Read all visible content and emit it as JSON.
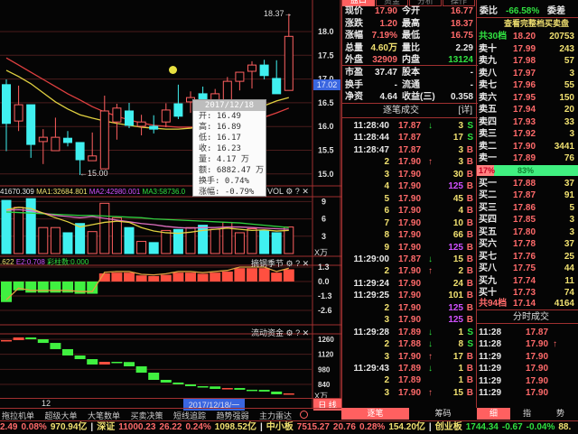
{
  "top_tabs": [
    "盘口",
    "资金",
    "分析",
    "操作"
  ],
  "kline": {
    "price_axis": [
      "18.0",
      "17.5",
      "17.0",
      "16.5",
      "16.0",
      "15.5",
      "15.0"
    ],
    "high_label": "18.37→",
    "low_label": "←15.00",
    "current_tag": "17.02",
    "candles": [
      [
        16.89,
        17.0,
        15.5,
        16.08
      ],
      [
        16.13,
        16.87,
        15.92,
        16.47
      ],
      [
        16.47,
        16.47,
        15.36,
        15.64
      ],
      [
        15.7,
        15.96,
        15.23,
        15.79
      ],
      [
        15.51,
        16.2,
        15.51,
        15.79
      ],
      [
        15.77,
        15.92,
        15.6,
        15.68
      ],
      [
        15.68,
        15.68,
        15.0,
        15.32
      ],
      [
        15.3,
        15.89,
        15.3,
        15.4
      ],
      [
        15.13,
        16.66,
        15.13,
        16.34
      ],
      [
        16.11,
        16.49,
        15.74,
        16.4
      ],
      [
        16.34,
        16.51,
        15.98,
        16.04
      ],
      [
        16.02,
        16.26,
        15.83,
        16.11
      ],
      [
        16.02,
        16.25,
        15.87,
        15.96
      ],
      [
        16.11,
        16.5,
        16.0,
        16.36
      ],
      [
        16.49,
        16.89,
        16.17,
        16.23
      ],
      [
        16.53,
        16.75,
        16.3,
        16.62
      ],
      [
        16.7,
        16.85,
        16.4,
        16.58
      ],
      [
        16.5,
        16.8,
        16.4,
        16.7
      ],
      [
        16.55,
        17.05,
        16.45,
        16.96
      ],
      [
        16.96,
        17.15,
        16.77,
        17.15
      ],
      [
        17.17,
        17.38,
        16.81,
        17.3
      ],
      [
        17.3,
        17.41,
        17.0,
        17.08
      ],
      [
        17.02,
        17.4,
        16.7,
        16.7
      ],
      [
        16.77,
        18.37,
        16.77,
        17.9
      ]
    ],
    "ma_short": [
      17.19,
      17.06,
      16.91,
      16.72,
      16.53,
      16.38,
      16.26,
      16.19,
      16.13,
      16.08,
      16.04,
      16.0,
      15.98,
      15.96,
      15.96,
      15.98,
      16.02,
      16.08,
      16.15,
      16.25,
      16.34,
      16.45,
      16.55,
      16.62
    ],
    "ma_long": [
      17.45,
      17.3,
      17.15,
      17.0,
      16.85,
      16.7,
      16.57,
      16.43,
      16.32,
      16.23,
      16.15,
      16.09,
      16.04,
      16.02,
      16.0,
      16.0,
      16.02,
      16.04,
      16.06,
      16.08,
      16.11,
      16.21,
      16.3,
      16.4
    ],
    "colors": {
      "up": "#ff6060",
      "down": "#40f0f0",
      "ma_short": "#e0d040",
      "ma_long": "#e04040"
    }
  },
  "tooltip": {
    "date": "2017/12/18",
    "rows": [
      "开: 16.49",
      "高: 16.89",
      "低: 16.17",
      "收: 16.23",
      "量: 4.17 万",
      "额: 6882.47 万",
      "换手: 0.74%",
      "涨幅: -0.79%"
    ]
  },
  "vol": {
    "legend": {
      "vol": "41670.309",
      "ma1": "MA1:32684.801",
      "ma2": "MA2:42980.001",
      "ma3": "MA3:58736.0"
    },
    "name": "VOL",
    "axis": [
      "9",
      "6",
      "3"
    ],
    "unit": "X万",
    "values": [
      9.2,
      8.0,
      9.5,
      4.5,
      4.5,
      3.6,
      5.2,
      3.8,
      8.7,
      6.2,
      4.5,
      2.1,
      1.9,
      4.0,
      4.17,
      4.5,
      4.9,
      4.2,
      5.4,
      3.6,
      4.3,
      4.0,
      3.6,
      4.6
    ],
    "ma1": [
      7.6,
      8.0,
      7.8,
      7.0,
      6.2,
      5.5,
      4.6,
      5.0,
      5.4,
      5.6,
      5.4,
      4.5,
      3.9,
      3.6,
      3.5,
      3.7,
      4.0,
      4.2,
      4.4,
      4.2,
      4.0,
      4.1,
      3.9,
      4.0
    ],
    "ma2": [
      7.5,
      7.6,
      7.4,
      7.0,
      6.6,
      6.4,
      6.2,
      6.4,
      6.1,
      5.8,
      5.5,
      5.2,
      5.0,
      4.7,
      4.5,
      4.4,
      4.5,
      4.5,
      4.6,
      4.6,
      4.5,
      4.4,
      4.3,
      4.2
    ],
    "ma3": [
      7.2,
      7.1,
      7.0,
      6.9,
      6.8,
      6.7,
      6.6,
      6.6,
      6.5,
      6.4,
      6.3,
      6.2,
      6.0,
      5.9,
      5.8,
      5.7,
      5.6,
      5.5,
      5.4,
      5.3,
      5.1,
      4.9,
      4.7,
      4.5
    ]
  },
  "macd": {
    "legend": {
      "e1": ".622",
      "e2": "E2:0.708",
      "bars": "彩柱数:0.000"
    },
    "name": "摘钢季节",
    "axis": [
      "1.3",
      "0.0",
      "-1.3",
      "-2.6"
    ],
    "values": [
      -1.85,
      -0.8,
      -1.0,
      -1.0,
      -1.0,
      -1.0,
      -1.1,
      -1.1,
      0.73,
      0.8,
      0.8,
      0.55,
      0.5,
      0.6,
      0.8,
      0.8,
      0.7,
      0.8,
      0.9,
      1.2,
      1.2,
      1.2,
      0.8,
      1.1
    ]
  },
  "flow": {
    "name": "流动资金",
    "axis": [
      "1260",
      "1120",
      "980",
      "840"
    ],
    "unit": "X万",
    "levels": [
      1245,
      1252,
      1277,
      1260,
      1226,
      1168,
      1109,
      1075,
      1025,
      1050,
      1048,
      1008,
      949,
      882,
      857,
      840,
      823,
      821,
      798,
      806,
      790,
      789,
      773,
      748,
      756
    ]
  },
  "datebar": {
    "tick": "12",
    "date": "2017/12/18/一",
    "period": "日 线"
  },
  "tabs": [
    "拖拉机单",
    "超级大单",
    "大笔数单",
    "买卖决策",
    "短线追踪",
    "趋势强弱",
    "主力雷达"
  ],
  "quote": [
    [
      "现价",
      "17.90",
      "今开",
      "16.77"
    ],
    [
      "涨跌",
      "1.20",
      "最高",
      "18.37"
    ],
    [
      "涨幅",
      "7.19%",
      "最低",
      "16.75"
    ],
    [
      "总量",
      "4.60万",
      "量比",
      "2.29"
    ],
    [
      "外盘",
      "32909",
      "内盘",
      "13124"
    ],
    [
      "市盈",
      "37.47",
      "股本",
      "-"
    ],
    [
      "换手",
      "-",
      "流通",
      "-"
    ],
    [
      "净资",
      "4.64",
      "收益(三)",
      "0.358"
    ]
  ],
  "ticks_header": {
    "title": "逐笔成交",
    "tag": "[详]"
  },
  "ticks": [
    [
      "11:28:40",
      "17.87",
      "↓",
      "3",
      "S"
    ],
    [
      "11:28:44",
      "17.87",
      "",
      "17",
      "S"
    ],
    [
      "11:28:47",
      "17.87",
      "",
      "3",
      "B"
    ],
    [
      "2",
      "17.90",
      "↑",
      "3",
      "B"
    ],
    [
      "3",
      "17.90",
      "",
      "30",
      "B"
    ],
    [
      "4",
      "17.90",
      "",
      "125",
      "B"
    ],
    [
      "5",
      "17.90",
      "",
      "45",
      "B"
    ],
    [
      "6",
      "17.90",
      "",
      "4",
      "B"
    ],
    [
      "7",
      "17.90",
      "",
      "10",
      "B"
    ],
    [
      "8",
      "17.90",
      "",
      "66",
      "B"
    ],
    [
      "9",
      "17.90",
      "",
      "125",
      "B"
    ],
    [
      "11:29:00",
      "17.87",
      "↓",
      "15",
      "B"
    ],
    [
      "2",
      "17.90",
      "↑",
      "2",
      "B"
    ],
    [
      "11:29:24",
      "17.90",
      "",
      "24",
      "B"
    ],
    [
      "11:29:25",
      "17.90",
      "",
      "101",
      "B"
    ],
    [
      "2",
      "17.90",
      "",
      "125",
      "B"
    ],
    [
      "3",
      "17.90",
      "",
      "125",
      "B"
    ],
    [
      "11:29:28",
      "17.89",
      "↓",
      "1",
      "S"
    ],
    [
      "2",
      "17.88",
      "↓",
      "8",
      "S"
    ],
    [
      "3",
      "17.90",
      "↑",
      "17",
      "B"
    ],
    [
      "11:29:43",
      "17.89",
      "↓",
      "1",
      "B"
    ],
    [
      "2",
      "17.89",
      "",
      "1",
      "B"
    ],
    [
      "3",
      "17.90",
      "↑",
      "15",
      "B"
    ]
  ],
  "orderbook": {
    "ratio_label": "委比",
    "ratio": "-66.58%",
    "diff_label": "委差",
    "full_link": "查看完整档买卖盘",
    "sell_total": [
      "共30档",
      "18.20",
      "20753"
    ],
    "sells": [
      [
        "卖十",
        "17.99",
        "243"
      ],
      [
        "卖九",
        "17.98",
        "57"
      ],
      [
        "卖八",
        "17.97",
        "3"
      ],
      [
        "卖七",
        "17.96",
        "55"
      ],
      [
        "卖六",
        "17.95",
        "150"
      ],
      [
        "卖五",
        "17.94",
        "20"
      ],
      [
        "卖四",
        "17.93",
        "33"
      ],
      [
        "卖三",
        "17.92",
        "3"
      ],
      [
        "卖二",
        "17.90",
        "3441"
      ],
      [
        "卖一",
        "17.89",
        "76"
      ]
    ],
    "bar": {
      "left": "17%",
      "right": "83%",
      "left_pct": 17
    },
    "buys": [
      [
        "买一",
        "17.88",
        "37"
      ],
      [
        "买二",
        "17.87",
        "91"
      ],
      [
        "买三",
        "17.86",
        "5"
      ],
      [
        "买四",
        "17.85",
        "3"
      ],
      [
        "买五",
        "17.80",
        "3"
      ],
      [
        "买六",
        "17.78",
        "37"
      ],
      [
        "买七",
        "17.76",
        "25"
      ],
      [
        "买八",
        "17.75",
        "44"
      ],
      [
        "买九",
        "17.74",
        "11"
      ],
      [
        "买十",
        "17.73",
        "74"
      ]
    ],
    "buy_total": [
      "共94档",
      "17.14",
      "4164"
    ]
  },
  "minute_header": "分时成交",
  "minute": [
    [
      "11:28",
      "17.87",
      ""
    ],
    [
      "11:28",
      "17.90",
      "↑"
    ],
    [
      "11:29",
      "17.90",
      ""
    ],
    [
      "11:29",
      "17.90",
      ""
    ],
    [
      "11:29",
      "17.90",
      ""
    ],
    [
      "11:29",
      "17.90",
      ""
    ]
  ],
  "bottom_tabs_mid": [
    "逐笔",
    "筹码"
  ],
  "bottom_tabs_right": [
    "细",
    "指",
    "势"
  ],
  "status": [
    {
      "t": "2.49",
      "c": "red"
    },
    {
      "t": "0.08%",
      "c": "red"
    },
    {
      "t": "970.94亿",
      "c": "yel"
    },
    {
      "t": "|",
      "c": "wht"
    },
    {
      "t": "深证",
      "c": "yel"
    },
    {
      "t": "11000.23",
      "c": "red"
    },
    {
      "t": "26.22",
      "c": "red"
    },
    {
      "t": "0.24%",
      "c": "red"
    },
    {
      "t": "1098.52亿",
      "c": "yel"
    },
    {
      "t": "|",
      "c": "wht"
    },
    {
      "t": "中小板",
      "c": "yel"
    },
    {
      "t": "7515.27",
      "c": "red"
    },
    {
      "t": "20.76",
      "c": "red"
    },
    {
      "t": "0.28%",
      "c": "red"
    },
    {
      "t": "154.20亿",
      "c": "yel"
    },
    {
      "t": "|",
      "c": "wht"
    },
    {
      "t": "创业板",
      "c": "yel"
    },
    {
      "t": "1744.34",
      "c": "grn"
    },
    {
      "t": "-0.67",
      "c": "grn"
    },
    {
      "t": "-0.04%",
      "c": "grn"
    },
    {
      "t": "88.",
      "c": "yel"
    }
  ]
}
